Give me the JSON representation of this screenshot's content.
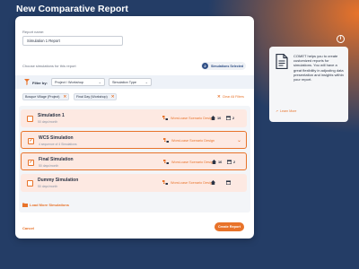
{
  "page": {
    "title": "New Comparative Report"
  },
  "form": {
    "name_label": "Report name:",
    "name_value": "Simulation 1 Report",
    "choose_label": "Choose simulations for this report",
    "selected_count": "2",
    "selected_label": "Simulations Selected"
  },
  "filters": {
    "label": "Filter by:",
    "project_placeholder": "Project / Workshop",
    "type_placeholder": "Simulation Type",
    "chips": [
      "Bosque Village (Project)",
      "Final Day (Workshop)"
    ],
    "clear_all": "Clear All Filters"
  },
  "simulations": [
    {
      "name": "Simulation 1",
      "subtitle": "50 days/month",
      "scenario": "Worst-case Scenario Design",
      "people": "10",
      "calendar": "2",
      "selected": false
    },
    {
      "name": "WCS Simulation",
      "subtitle": "4 sequence of 4 Simulations",
      "scenario": "Worst-case Scenario Design",
      "people": "",
      "calendar": "",
      "selected": true
    },
    {
      "name": "Final Simulation",
      "subtitle": "50 days/month",
      "scenario": "Worst-case Scenario Design",
      "people": "16",
      "calendar": "2",
      "selected": true
    },
    {
      "name": "Dummy Simulation",
      "subtitle": "50 days/month",
      "scenario": "Worst-case Scenario Design",
      "people": "",
      "calendar": "",
      "selected": false
    }
  ],
  "actions": {
    "load_more": "Load More Simulations",
    "cancel": "Cancel",
    "create": "Create Report"
  },
  "info": {
    "toggle": "i",
    "text": "COMET helps you to create customized reports for simulations. You will have a great flexibility in adjusting data presentation and insights within your report.",
    "learn_more": "Learn More"
  },
  "colors": {
    "accent": "#e8732a",
    "navy": "#243d66",
    "row_bg": "#fde9e2"
  },
  "icons": {
    "checkbox": "check-icon",
    "scenario": "scenario-icon",
    "people": "home-icon",
    "calendar": "calendar-icon"
  }
}
